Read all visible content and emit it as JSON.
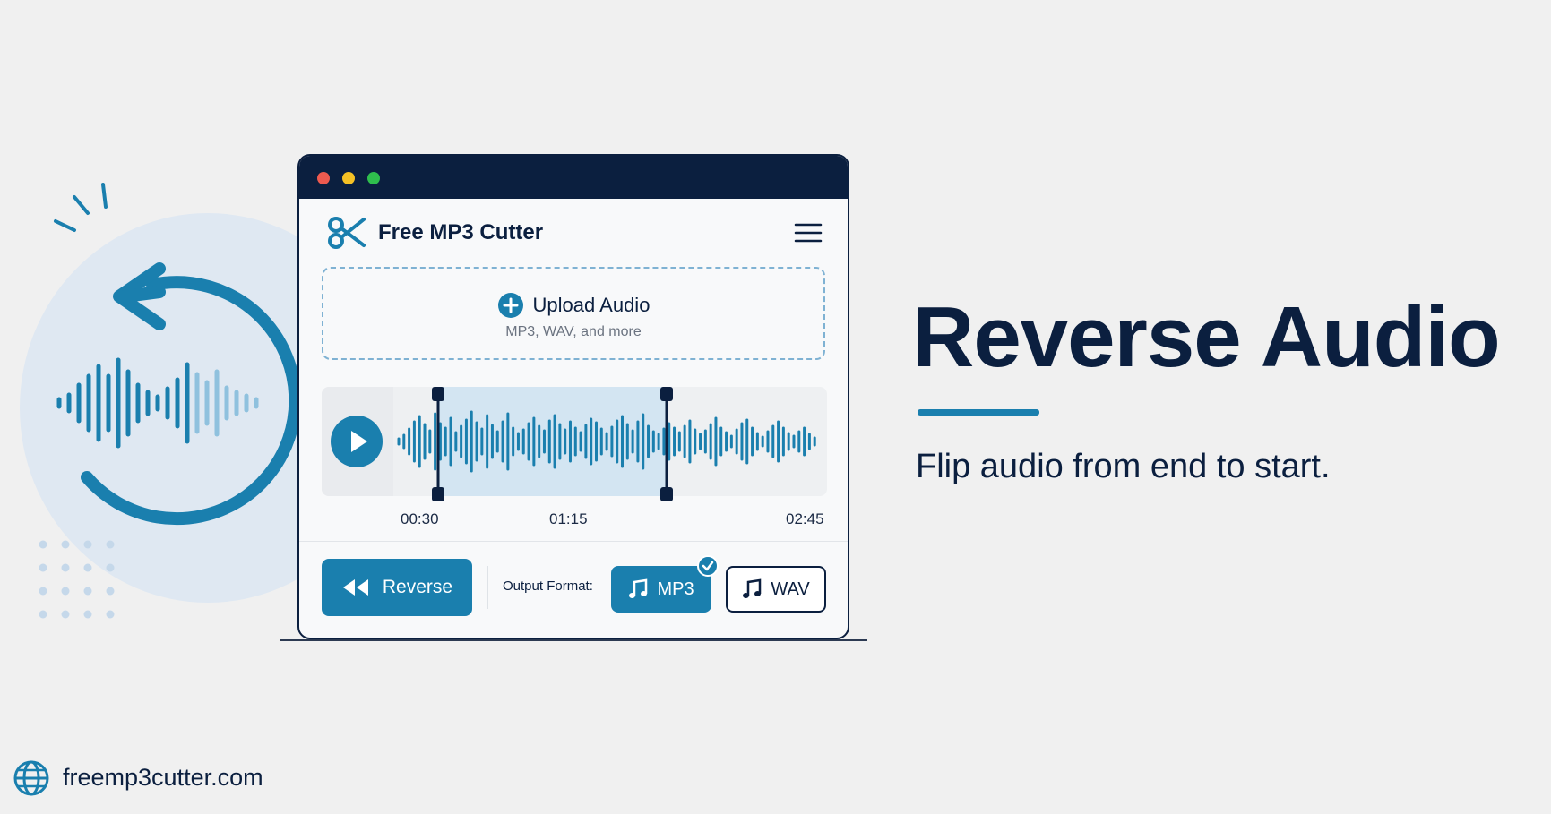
{
  "app": {
    "title": "Free MP3 Cutter",
    "logo_icon": "scissors-icon",
    "menu_icon": "hamburger-menu-icon"
  },
  "upload": {
    "label": "Upload Audio",
    "sublabel": "MP3, WAV, and more",
    "icon": "plus-circle-icon"
  },
  "player": {
    "play_icon": "play-icon",
    "times": [
      "00:30",
      "01:15",
      "02:45"
    ]
  },
  "actions": {
    "reverse_label": "Reverse",
    "reverse_icon": "rewind-icon",
    "output_format_label": "Output Format:",
    "formats": [
      {
        "label": "MP3",
        "selected": true,
        "icon": "music-note-icon"
      },
      {
        "label": "WAV",
        "selected": false,
        "icon": "music-note-icon"
      }
    ]
  },
  "hero": {
    "headline": "Reverse Audio",
    "tagline": "Flip audio from end to start."
  },
  "footer": {
    "url": "freemp3cutter.com",
    "icon": "globe-icon"
  },
  "colors": {
    "accent": "#1a7fae",
    "navy": "#0b1f3f",
    "background": "#f0f0f0",
    "selection": "#d3e5f2"
  }
}
